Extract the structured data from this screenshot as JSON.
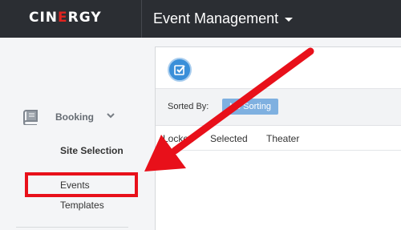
{
  "header": {
    "logo_left": "CIN",
    "logo_e": "E",
    "logo_right": "RGY",
    "module": "Event Management"
  },
  "sidebar": {
    "booking_label": "Booking",
    "items": [
      {
        "label": "Site Selection"
      },
      {
        "label": "Events"
      },
      {
        "label": "Templates"
      }
    ]
  },
  "main": {
    "sorted_by_label": "Sorted By:",
    "sort_chip_label": "No Sorting",
    "columns": [
      "Locked",
      "Selected",
      "Theater"
    ]
  },
  "colors": {
    "topbar": "#2b2e33",
    "brand_red": "#e0231f",
    "accent_blue": "#3a8fd9",
    "annotation_red": "#e8101a"
  },
  "icons": [
    "book-icon",
    "chevron-down-icon",
    "checkbox-icon",
    "caret-down-icon"
  ]
}
